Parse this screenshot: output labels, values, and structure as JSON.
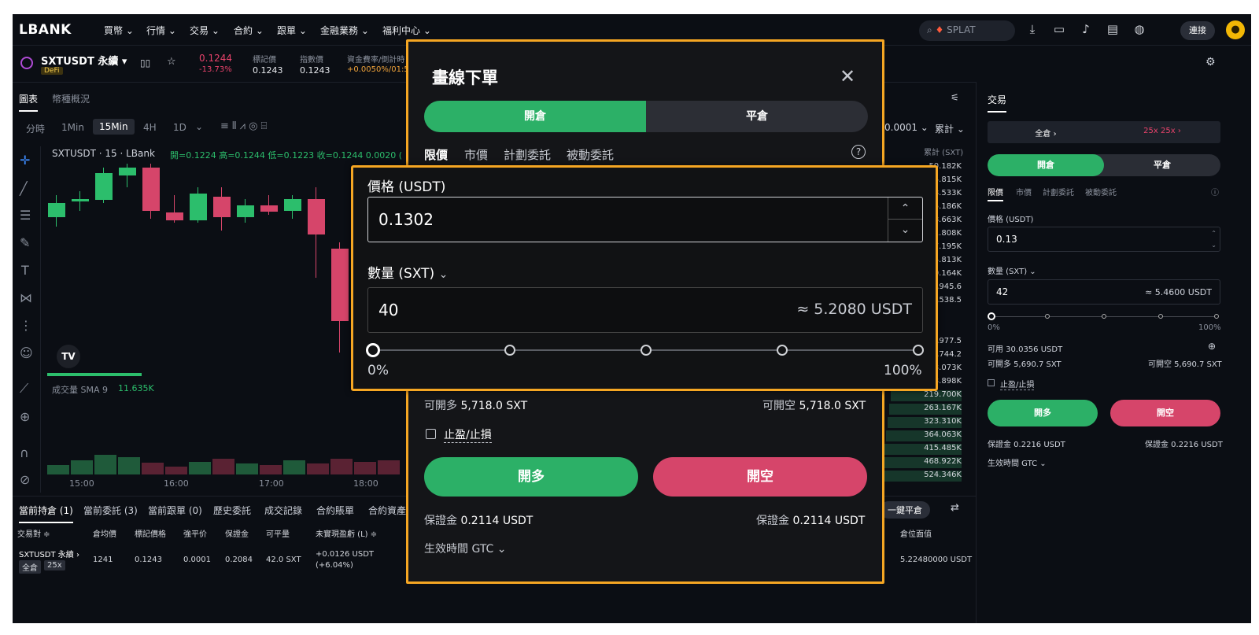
{
  "nav": {
    "logo": "LBANK",
    "menu": [
      "買幣 ⌄",
      "行情 ⌄",
      "交易 ⌄",
      "合約 ⌄",
      "跟單 ⌄",
      "金融業務 ⌄",
      "福利中心 ⌄"
    ],
    "search_placeholder": "SPLAT",
    "connect": "連接"
  },
  "symbol": {
    "name": "SXTUSDT 永續 ▾",
    "tag": "DeFi",
    "price": "0.1244",
    "change": "-13.73%",
    "mark_label": "標記價",
    "mark_value": "0.1243",
    "index_label": "指數價",
    "index_value": "0.1243",
    "funding_label": "資金費率/倒計時",
    "funding_value": "+0.0050%/01:57"
  },
  "chart": {
    "tabs": [
      "圖表",
      "幣種概況"
    ],
    "intervals": [
      "分時",
      "1Min",
      "15Min",
      "4H",
      "1D"
    ],
    "legend_title": "SXTUSDT · 15 · LBank",
    "ohlc": "開=0.1224 高=0.1244 低=0.1223 收=0.1244 0.0020 (",
    "volume_label": "成交量 SMA 9",
    "volume_value": "11.635K",
    "times": [
      "15:00",
      "16:00",
      "17:00",
      "18:00"
    ]
  },
  "orderbook": {
    "tick": "0.0001 ⌄",
    "cum": "累計 ⌄",
    "cum_header": "累計 (SXT)",
    "values": [
      "50.182K",
      "4.815K",
      "8.533K",
      "5.186K",
      "8.663K",
      "1.808K",
      "7.195K",
      "4.813K",
      "0.164K",
      "5,945.6",
      "0,538.5",
      "0,977.5",
      "9,744.2",
      "3.073K",
      "3.898K",
      "219.700K",
      "263.167K",
      "323.310K",
      "364.063K",
      "415.485K",
      "468.922K",
      "524.346K"
    ]
  },
  "bottom": {
    "tabs": [
      "當前持倉 (1)",
      "當前委託 (3)",
      "當前跟單 (0)",
      "歷史委託",
      "成交記錄",
      "合約賬單",
      "合約資產"
    ],
    "one_click": "一鍵平倉",
    "headers": [
      "交易對 ≑",
      "倉均價",
      "標記價格",
      "強平价",
      "保證金",
      "可平量",
      "未實現盈虧 (L) ≑",
      "倉位面值"
    ],
    "row": {
      "pair": "SXTUSDT 永續 ›",
      "mode": "全倉",
      "lev": "25x",
      "avg": "1241",
      "mark": "0.1243",
      "liq": "0.0001",
      "margin": "0.2084",
      "qty": "42.0 SXT",
      "pnl": "+0.0126 USDT",
      "pnl_pct": "(+6.04%)",
      "value": "5.22480000 USDT"
    }
  },
  "modal": {
    "title": "畫線下單",
    "open": "開倉",
    "close": "平倉",
    "order_tabs": [
      "限價",
      "市價",
      "計劃委託",
      "被動委託"
    ],
    "price_label": "價格 (USDT)",
    "price_value": "0.1302",
    "qty_label": "數量 (SXT)",
    "qty_value": "40",
    "qty_approx": "≈ 5.2080 USDT",
    "slider_min": "0%",
    "slider_max": "100%",
    "can_long_label": "可開多",
    "can_long": "5,718.0 SXT",
    "can_short_label": "可開空",
    "can_short": "5,718.0 SXT",
    "tpsl": "止盈/止損",
    "buy_long": "開多",
    "sell_short": "開空",
    "margin_label": "保證金",
    "margin_long": "0.2114 USDT",
    "margin_short": "0.2114 USDT",
    "tif": "生效時間 GTC ⌄"
  },
  "right": {
    "title": "交易",
    "mode": "全倉 ›",
    "lev": "25x 25x ›",
    "open": "開倉",
    "close": "平倉",
    "order_tabs": [
      "限價",
      "市價",
      "計劃委託",
      "被動委託"
    ],
    "price_label": "價格 (USDT)",
    "price_value": "0.13",
    "qty_label": "數量 (SXT) ⌄",
    "qty_value": "42",
    "qty_approx": "≈ 5.4600 USDT",
    "slider_min": "0%",
    "slider_max": "100%",
    "available": "可用 30.0356 USDT",
    "can_long": "可開多 5,690.7 SXT",
    "can_short": "可開空 5,690.7 SXT",
    "tpsl": "止盈/止損",
    "buy_long": "開多",
    "sell_short": "開空",
    "margin_long": "保證金 0.2216 USDT",
    "margin_short": "保證金 0.2216 USDT",
    "tif": "生效時間 GTC ⌄"
  },
  "colors": {
    "accent": "#f5a623",
    "green": "#2cb067",
    "red": "#d6456a"
  }
}
